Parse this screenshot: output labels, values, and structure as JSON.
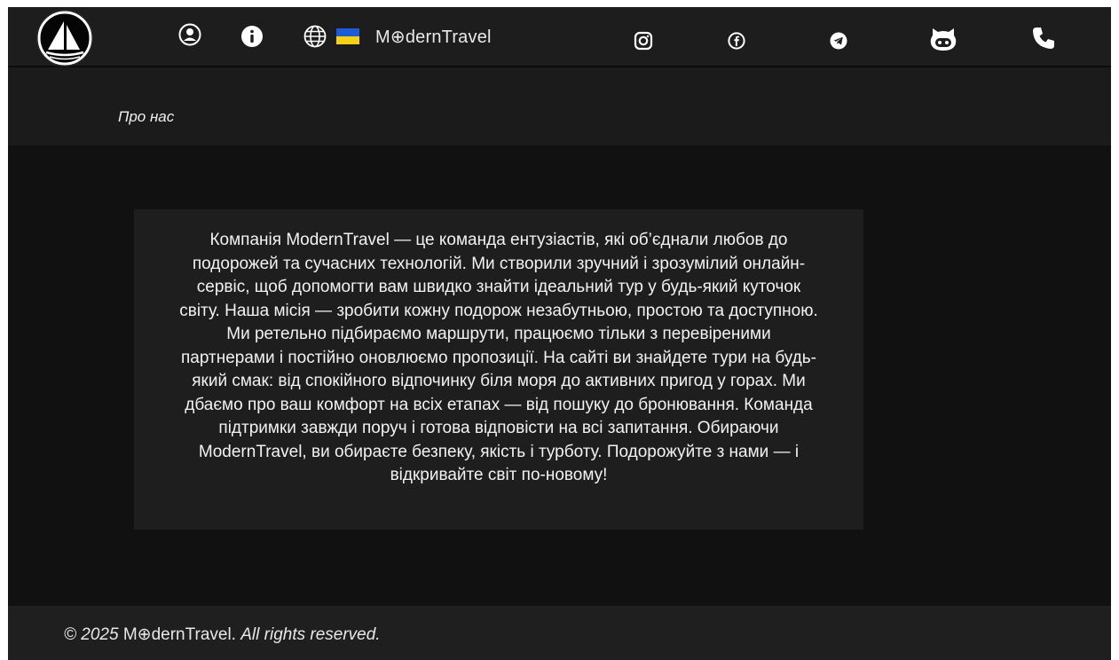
{
  "header": {
    "brand": "M⊕dernTravel",
    "icons": {
      "logo": "sailboat-logo",
      "profile": "user-circle-icon",
      "info": "info-icon",
      "language": "globe-icon",
      "flag": "ukraine-flag-icon",
      "instagram": "instagram-icon",
      "facebook": "facebook-icon",
      "telegram": "telegram-icon",
      "github": "github-icon",
      "phone": "phone-icon"
    }
  },
  "breadcrumb": {
    "label": "Про нас"
  },
  "about": {
    "text": "Компанія ModernTravel — це команда ентузіастів, які об’єднали любов до подорожей та сучасних технологій. Ми створили зручний і зрозумілий онлайн-сервіс, щоб допомогти вам швидко знайти ідеальний тур у будь-який куточок світу. Наша місія — зробити кожну подорож незабутньою, простою та доступною. Ми ретельно підбираємо маршрути, працюємо тільки з перевіреними партнерами і постійно оновлюємо пропозиції. На сайті ви знайдете тури на будь-який смак: від спокійного відпочинку біля моря до активних пригод у горах. Ми дбаємо про ваш комфорт на всіх етапах — від пошуку до бронювання. Команда підтримки завжди поруч і готова відповісти на всі запитання. Обираючи ModernTravel, ви обираєте безпеку, якість і турботу. Подорожуйте з нами — і відкривайте світ по-новому!"
  },
  "footer": {
    "year": "© 2025",
    "brand": "M⊕dernTravel.",
    "rights": "All rights reserved."
  },
  "colors": {
    "background": "#111111",
    "header": "#1d1d1d",
    "card": "#1e1e1e",
    "text": "#f2f2f2",
    "flag_blue": "#1e5bd6",
    "flag_yellow": "#f7d117"
  }
}
